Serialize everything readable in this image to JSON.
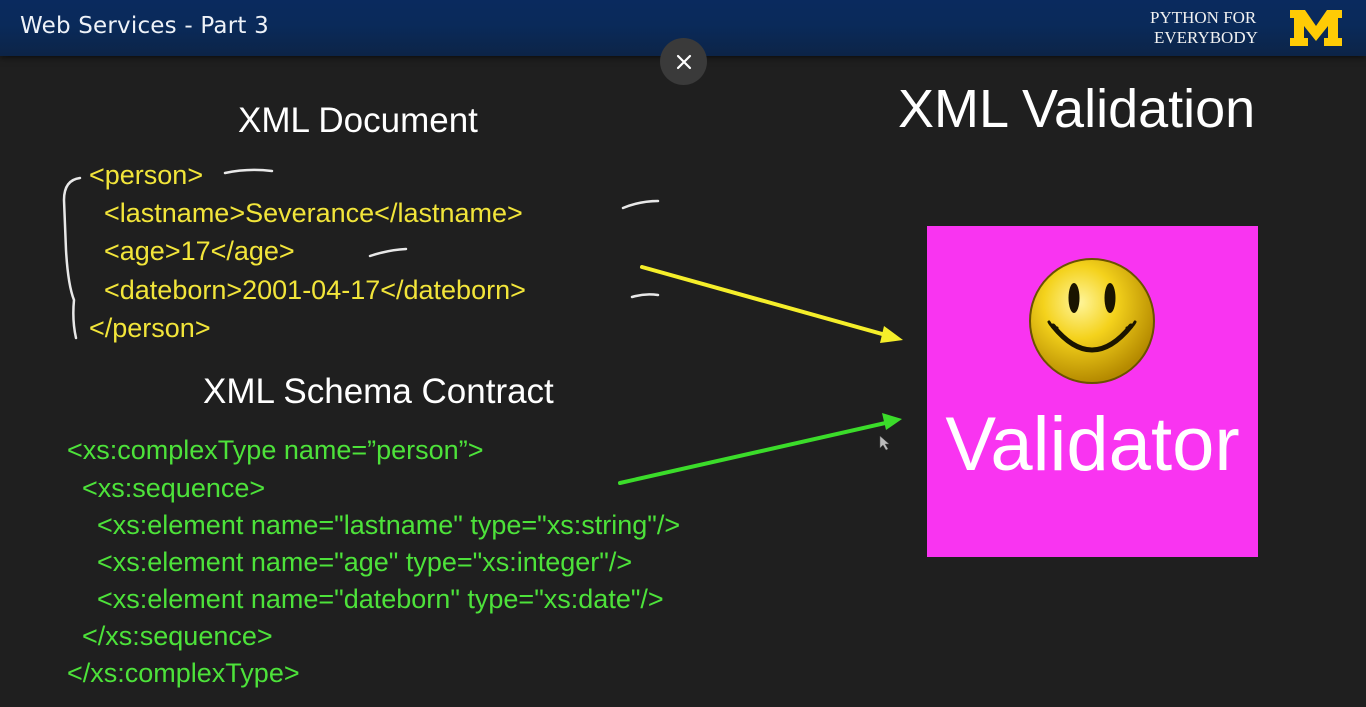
{
  "header": {
    "title": "Web Services - Part 3",
    "brand_line1": "PYTHON FOR",
    "brand_line2": "EVERYBODY",
    "brand_logo": "university-of-michigan-block-m",
    "brand_color": "#ffcb05"
  },
  "close_button": {
    "icon": "close-icon"
  },
  "slide": {
    "title": "XML Validation",
    "xml_document": {
      "heading": "XML Document",
      "lines": [
        "<person>",
        "  <lastname>Severance</lastname>",
        "  <age>17</age>",
        "  <dateborn>2001-04-17</dateborn>",
        "</person>"
      ]
    },
    "schema": {
      "heading": "XML Schema Contract",
      "lines": [
        "<xs:complexType name=”person”>",
        "  <xs:sequence>",
        "    <xs:element name=\"lastname\" type=\"xs:string\"/>",
        "    <xs:element name=\"age\" type=\"xs:integer\"/>",
        "    <xs:element name=\"dateborn\" type=\"xs:date\"/>",
        "  </xs:sequence>",
        "</xs:complexType>"
      ]
    },
    "validator": {
      "label": "Validator",
      "icon": "smiley-face-icon",
      "box_color": "#f934f1"
    },
    "colors": {
      "xml_text": "#f2e53a",
      "schema_text": "#4de23a",
      "yellow_arrow": "#f5ee2a",
      "green_arrow": "#3bdc2a"
    }
  }
}
